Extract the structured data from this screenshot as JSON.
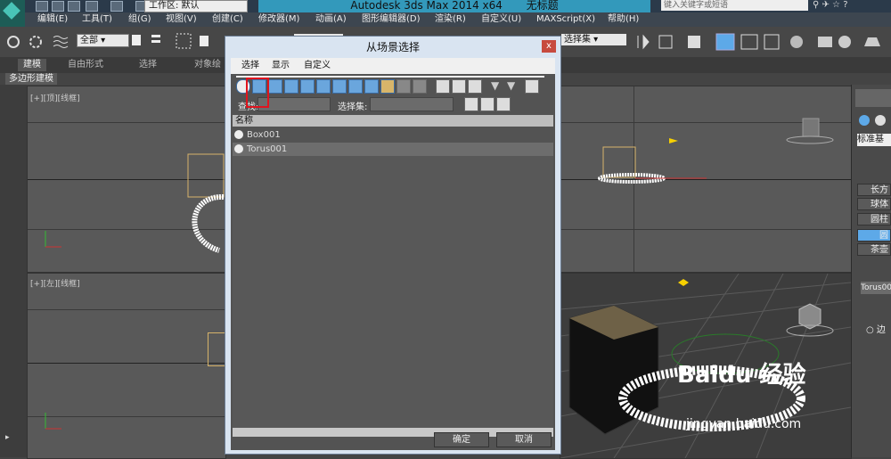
{
  "app": {
    "title": "Autodesk 3ds Max  2014 x64",
    "document": "无标题",
    "workspace_label": "工作区: 默认",
    "search_placeholder": "键入关键字或短语"
  },
  "menus": [
    "编辑(E)",
    "工具(T)",
    "组(G)",
    "视图(V)",
    "创建(C)",
    "修改器(M)",
    "动画(A)",
    "图形编辑器(D)",
    "渲染(R)",
    "自定义(U)",
    "MAXScript(X)",
    "帮助(H)"
  ],
  "toolbar": {
    "selection_filter": "全部",
    "selection_set": "选择集"
  },
  "ribbon": {
    "tabs": [
      "建模",
      "自由形式",
      "选择",
      "对象绘"
    ],
    "panel_label": "多边形建模"
  },
  "viewports": {
    "top": "[+][顶][线框]",
    "left": "[+][左][线框]"
  },
  "command_panel": {
    "dropdown": "标准基本",
    "buttons": [
      "长方",
      "球体",
      "圆柱",
      "圆",
      "茶壶"
    ],
    "name_field": "Torus00",
    "radio": "边"
  },
  "dialog": {
    "title": "从场景选择",
    "close": "x",
    "menus": [
      "选择",
      "显示",
      "自定义"
    ],
    "find_label": "查找:",
    "selset_label": "选择集:",
    "column_header": "名称",
    "rows": [
      "Box001",
      "Torus001"
    ],
    "ok": "确定",
    "cancel": "取消"
  },
  "watermark": {
    "brand": "Baidu 经验",
    "url": "jingyan.baidu.com"
  }
}
